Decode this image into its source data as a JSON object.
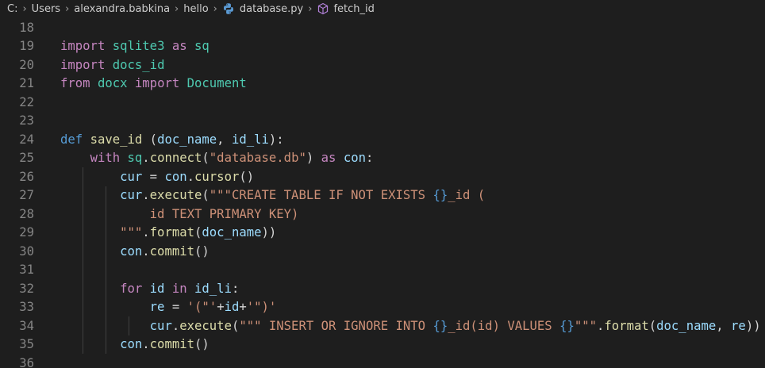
{
  "breadcrumb": {
    "items": [
      "C:",
      "Users",
      "alexandra.babkina",
      "hello",
      "database.py",
      "fetch_id"
    ],
    "file_icon": "python-icon",
    "symbol_icon": "symbol-method-icon"
  },
  "editor": {
    "lines": [
      {
        "n": "18",
        "tokens": []
      },
      {
        "n": "19",
        "tokens": [
          [
            "kw",
            "import"
          ],
          [
            "plain",
            " "
          ],
          [
            "mod",
            "sqlite3"
          ],
          [
            "plain",
            " "
          ],
          [
            "kw",
            "as"
          ],
          [
            "plain",
            " "
          ],
          [
            "mod",
            "sq"
          ]
        ]
      },
      {
        "n": "20",
        "tokens": [
          [
            "kw",
            "import"
          ],
          [
            "plain",
            " "
          ],
          [
            "mod",
            "docs_id"
          ]
        ]
      },
      {
        "n": "21",
        "tokens": [
          [
            "kw",
            "from"
          ],
          [
            "plain",
            " "
          ],
          [
            "mod",
            "docx"
          ],
          [
            "plain",
            " "
          ],
          [
            "kw",
            "import"
          ],
          [
            "plain",
            " "
          ],
          [
            "mod",
            "Document"
          ]
        ]
      },
      {
        "n": "22",
        "tokens": []
      },
      {
        "n": "23",
        "tokens": []
      },
      {
        "n": "24",
        "tokens": [
          [
            "def",
            "def"
          ],
          [
            "plain",
            " "
          ],
          [
            "fn",
            "save_id"
          ],
          [
            "plain",
            " ("
          ],
          [
            "var",
            "doc_name"
          ],
          [
            "plain",
            ", "
          ],
          [
            "var",
            "id_li"
          ],
          [
            "plain",
            "):"
          ]
        ]
      },
      {
        "n": "25",
        "tokens": [
          [
            "plain",
            "    "
          ],
          [
            "kw",
            "with"
          ],
          [
            "plain",
            " "
          ],
          [
            "mod",
            "sq"
          ],
          [
            "plain",
            "."
          ],
          [
            "fn",
            "connect"
          ],
          [
            "plain",
            "("
          ],
          [
            "str",
            "\"database.db\""
          ],
          [
            "plain",
            ") "
          ],
          [
            "kw",
            "as"
          ],
          [
            "plain",
            " "
          ],
          [
            "var",
            "con"
          ],
          [
            "plain",
            ":"
          ]
        ]
      },
      {
        "n": "26",
        "tokens": [
          [
            "plain",
            "        "
          ],
          [
            "var",
            "cur"
          ],
          [
            "plain",
            " = "
          ],
          [
            "var",
            "con"
          ],
          [
            "plain",
            "."
          ],
          [
            "fn",
            "cursor"
          ],
          [
            "plain",
            "()"
          ]
        ]
      },
      {
        "n": "27",
        "tokens": [
          [
            "plain",
            "        "
          ],
          [
            "var",
            "cur"
          ],
          [
            "plain",
            "."
          ],
          [
            "fn",
            "execute"
          ],
          [
            "plain",
            "("
          ],
          [
            "str",
            "\"\"\"CREATE TABLE IF NOT EXISTS "
          ],
          [
            "fmt",
            "{}"
          ],
          [
            "str",
            "_id ("
          ]
        ]
      },
      {
        "n": "28",
        "tokens": [
          [
            "plain",
            "            "
          ],
          [
            "str",
            "id TEXT PRIMARY KEY)"
          ]
        ]
      },
      {
        "n": "29",
        "tokens": [
          [
            "plain",
            "        "
          ],
          [
            "str",
            "\"\"\""
          ],
          [
            "plain",
            "."
          ],
          [
            "fn",
            "format"
          ],
          [
            "plain",
            "("
          ],
          [
            "var",
            "doc_name"
          ],
          [
            "plain",
            "))"
          ]
        ]
      },
      {
        "n": "30",
        "tokens": [
          [
            "plain",
            "        "
          ],
          [
            "var",
            "con"
          ],
          [
            "plain",
            "."
          ],
          [
            "fn",
            "commit"
          ],
          [
            "plain",
            "()"
          ]
        ]
      },
      {
        "n": "31",
        "tokens": []
      },
      {
        "n": "32",
        "tokens": [
          [
            "plain",
            "        "
          ],
          [
            "kw",
            "for"
          ],
          [
            "plain",
            " "
          ],
          [
            "var",
            "id"
          ],
          [
            "plain",
            " "
          ],
          [
            "kw",
            "in"
          ],
          [
            "plain",
            " "
          ],
          [
            "var",
            "id_li"
          ],
          [
            "plain",
            ":"
          ]
        ]
      },
      {
        "n": "33",
        "tokens": [
          [
            "plain",
            "            "
          ],
          [
            "var",
            "re"
          ],
          [
            "plain",
            " = "
          ],
          [
            "str",
            "'(\"'"
          ],
          [
            "plain",
            "+"
          ],
          [
            "var",
            "id"
          ],
          [
            "plain",
            "+"
          ],
          [
            "str",
            "'\")'"
          ]
        ]
      },
      {
        "n": "34",
        "tokens": [
          [
            "plain",
            "            "
          ],
          [
            "var",
            "cur"
          ],
          [
            "plain",
            "."
          ],
          [
            "fn",
            "execute"
          ],
          [
            "plain",
            "("
          ],
          [
            "str",
            "\"\"\" INSERT OR IGNORE INTO "
          ],
          [
            "fmt",
            "{}"
          ],
          [
            "str",
            "_id(id) VALUES "
          ],
          [
            "fmt",
            "{}"
          ],
          [
            "str",
            "\"\"\""
          ],
          [
            "plain",
            "."
          ],
          [
            "fn",
            "format"
          ],
          [
            "plain",
            "("
          ],
          [
            "var",
            "doc_name"
          ],
          [
            "plain",
            ", "
          ],
          [
            "var",
            "re"
          ],
          [
            "plain",
            "))"
          ]
        ]
      },
      {
        "n": "35",
        "tokens": [
          [
            "plain",
            "        "
          ],
          [
            "var",
            "con"
          ],
          [
            "plain",
            "."
          ],
          [
            "fn",
            "commit"
          ],
          [
            "plain",
            "()"
          ]
        ]
      },
      {
        "n": "36",
        "tokens": []
      }
    ]
  }
}
